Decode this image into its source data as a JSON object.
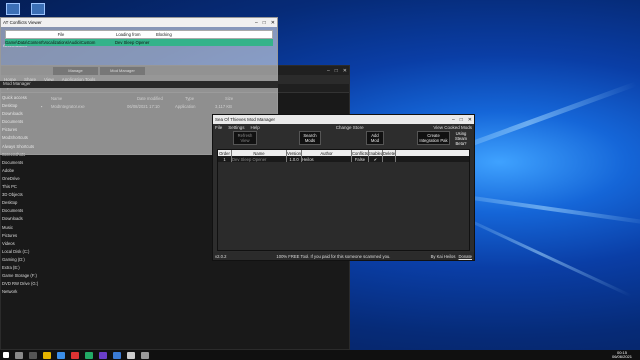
{
  "desktop": {
    "icons": [
      "Recycle Bin",
      "GiveMe...",
      "GreenScreen",
      "Installer",
      "Settings"
    ]
  },
  "conflict_viewer": {
    "title": "AT Conflicts Viewer",
    "columns": [
      "File",
      "Loading from",
      "Blocking"
    ],
    "row": {
      "file": "Game\\Data\\Content\\Vocalizations\\Audio\\Custom",
      "loading_from": "Dev Sleep Opener",
      "blocking": ""
    },
    "tabs": [
      "Manage",
      "Mod Manager"
    ]
  },
  "mod_manager_bar": {
    "label": "Mod Manager"
  },
  "explorer": {
    "title": "",
    "ribbon": [
      "Home",
      "Share",
      "View",
      "Application Tools"
    ],
    "nav": [
      "Quick access",
      "Desktop",
      "Downloads",
      "Documents",
      "Pictures",
      "ModShortcuts",
      "Always Shortcuts",
      "Screenshots",
      "Documents",
      "Adobe",
      "OneDrive",
      "This PC",
      "3D Objects",
      "Desktop",
      "Documents",
      "Downloads",
      "Music",
      "Pictures",
      "Videos",
      "Local Disk (C:)",
      "Gaming (D:)",
      "Extra (E:)",
      "Game Storage (F:)",
      "DVD RW Drive (G:) TM1",
      "Network"
    ],
    "columns": [
      "Name",
      "Date modified",
      "Type",
      "Size"
    ],
    "rows": [
      {
        "name": "ModIntegrator.exe",
        "date": "06/08/2021 17:10",
        "type": "Application",
        "size": "3,117 KB"
      }
    ]
  },
  "mod_switcher": {
    "title": "Sea Of Thieves Mod Manager",
    "menu": [
      "File",
      "Settings",
      "Help"
    ],
    "change_store": "Change Store",
    "view_cooked": "View Cooked Mods",
    "buttons": {
      "refresh": "Refresh View",
      "search": "Search Mods",
      "add": "Add Mod",
      "integration": "Create Integration Pak",
      "steam_beta": "Using Steam Beta?"
    },
    "grid_columns": [
      "Order",
      "Name",
      "Version",
      "Author",
      "Conflicts",
      "Enabled",
      "Delete"
    ],
    "grid_rows": [
      {
        "order": "1",
        "name": "Dev Sleep Opener",
        "version": "1.0.0",
        "author": "Heilos",
        "conflicts": "False",
        "enabled": "✔",
        "delete": ""
      }
    ],
    "status": {
      "version": "v2.0.2",
      "message": "100% FREE Tool. If you paid for this someone scammed you.",
      "credit": "By Kai Heilos",
      "donate": "Donate"
    }
  },
  "taskbar": {
    "clock_time": "00:15",
    "clock_date": "06/06/2021"
  },
  "colors": {
    "accent": "#34b38a",
    "desktop_bg": "#0a3ea6"
  }
}
